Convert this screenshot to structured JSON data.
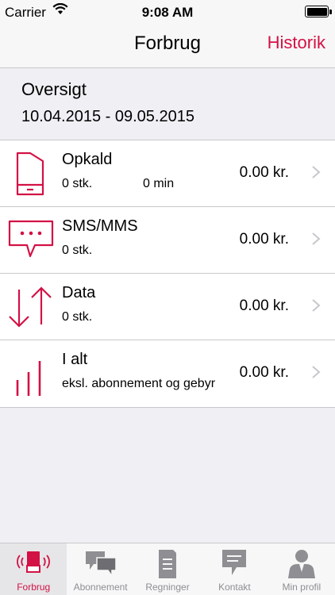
{
  "status_bar": {
    "carrier": "Carrier",
    "time": "9:08 AM"
  },
  "nav": {
    "title": "Forbrug",
    "right_button": "Historik"
  },
  "overview": {
    "heading": "Oversigt",
    "date_range": "10.04.2015 - 09.05.2015"
  },
  "usage_rows": [
    {
      "label": "Opkald",
      "count": "0 stk.",
      "duration": "0 min",
      "amount": "0.00 kr.",
      "icon": "phone-icon"
    },
    {
      "label": "SMS/MMS",
      "count": "0 stk.",
      "amount": "0.00 kr.",
      "icon": "message-bubble-icon"
    },
    {
      "label": "Data",
      "count": "0 stk.",
      "amount": "0.00 kr.",
      "icon": "data-arrows-icon"
    },
    {
      "label": "I alt",
      "count": "eksl. abonnement og gebyr",
      "amount": "0.00 kr.",
      "icon": "bars-icon"
    }
  ],
  "tabs": [
    {
      "label": "Forbrug",
      "icon": "usage-phone-icon",
      "active": true
    },
    {
      "label": "Abonnement",
      "icon": "chat-bubbles-icon",
      "active": false
    },
    {
      "label": "Regninger",
      "icon": "invoice-icon",
      "active": false
    },
    {
      "label": "Kontakt",
      "icon": "contact-bubble-icon",
      "active": false
    },
    {
      "label": "Min profil",
      "icon": "profile-person-icon",
      "active": false
    }
  ],
  "colors": {
    "accent": "#d31145",
    "tab_inactive": "#8e8e93",
    "background": "#efeff4",
    "separator": "#c8c8cc"
  }
}
